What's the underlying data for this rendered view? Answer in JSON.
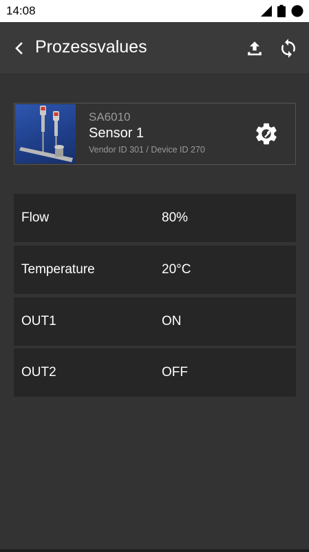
{
  "status_bar": {
    "time": "14:08",
    "icons": [
      "signal-icon",
      "battery-icon",
      "circle-icon"
    ]
  },
  "app_bar": {
    "title": "Prozessvalues",
    "back_icon": "chevron-left-icon",
    "upload_icon": "upload-icon",
    "refresh_icon": "refresh-icon"
  },
  "device": {
    "model": "SA6010",
    "name": "Sensor 1",
    "ids": "Vendor ID 301 / Device ID 270",
    "settings_icon": "settings-wrench-icon"
  },
  "process_values": [
    {
      "label": "Flow",
      "value": "80%"
    },
    {
      "label": "Temperature",
      "value": "20°C"
    },
    {
      "label": "OUT1",
      "value": "ON"
    },
    {
      "label": "OUT2",
      "value": "OFF"
    }
  ],
  "colors": {
    "background": "#333333",
    "app_bar": "#3a3a3a",
    "row": "#262626",
    "secondary_text": "#9a9a9a",
    "image_blue": "#2e57b0"
  }
}
